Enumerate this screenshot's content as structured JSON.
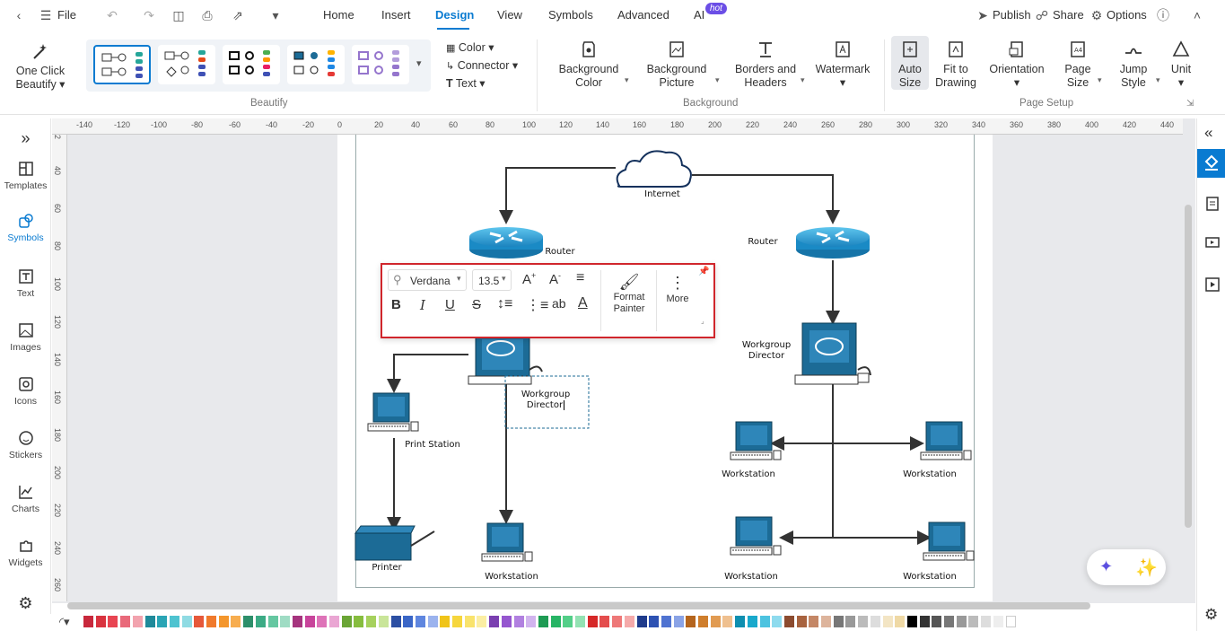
{
  "topbar": {
    "file": "File",
    "tabs": [
      "Home",
      "Insert",
      "Design",
      "View",
      "Symbols",
      "Advanced",
      "AI"
    ],
    "ai_badge": "hot",
    "active_tab": "Design",
    "publish": "Publish",
    "share": "Share",
    "options": "Options"
  },
  "ribbon": {
    "one_click_beautify": [
      "One Click",
      "Beautify"
    ],
    "color": "Color",
    "connector": "Connector",
    "text": "Text",
    "beautify_label": "Beautify",
    "background_color": [
      "Background",
      "Color"
    ],
    "background_picture": [
      "Background",
      "Picture"
    ],
    "borders_headers": [
      "Borders and",
      "Headers"
    ],
    "watermark": "Watermark",
    "background_label": "Background",
    "auto_size": [
      "Auto",
      "Size"
    ],
    "fit_to_drawing": [
      "Fit to",
      "Drawing"
    ],
    "orientation": "Orientation",
    "page_size": [
      "Page",
      "Size"
    ],
    "jump_style": [
      "Jump",
      "Style"
    ],
    "unit": "Unit",
    "page_setup_label": "Page Setup"
  },
  "leftbar": [
    "Templates",
    "Symbols",
    "Text",
    "Images",
    "Icons",
    "Stickers",
    "Charts",
    "Widgets"
  ],
  "ruler_top": [
    "-140",
    "-120",
    "-100",
    "-80",
    "-60",
    "-40",
    "-20",
    "0",
    "20",
    "40",
    "60",
    "80",
    "100",
    "120",
    "140",
    "160",
    "180",
    "200",
    "220",
    "240",
    "260",
    "280",
    "300",
    "320",
    "340",
    "360",
    "380",
    "400",
    "420",
    "440"
  ],
  "ruler_left": [
    "2",
    "40",
    "60",
    "80",
    "100",
    "120",
    "140",
    "160",
    "180",
    "200",
    "220",
    "240",
    "260"
  ],
  "diagram": {
    "internet": "Internet",
    "router_left": "Router",
    "router_right": "Router",
    "workgroup_director_left": [
      "Workgroup",
      "Director"
    ],
    "workgroup_director_right": [
      "Workgroup",
      "Director"
    ],
    "print_station": "Print Station",
    "printer": "Printer",
    "workstation": "Workstation"
  },
  "textbar": {
    "font": "Verdana",
    "size": "13.5",
    "format_painter": [
      "Format",
      "Painter"
    ],
    "more": "More"
  },
  "colors": {
    "accent": "#0a7bd1",
    "highlight_border": "#d0262c",
    "device_blue": "#1c6b96"
  },
  "palette": [
    "#c8283c",
    "#d9333f",
    "#e84552",
    "#e9697a",
    "#f2a3ae",
    "#1f8a9a",
    "#2aa5b5",
    "#4ec3d0",
    "#8fdbe3",
    "#e6583a",
    "#f07a2c",
    "#f4962c",
    "#f7ad4f",
    "#2d8f6a",
    "#3cab85",
    "#65c7a1",
    "#9fdcc4",
    "#a6347e",
    "#c8449b",
    "#de73b8",
    "#eaa6d3",
    "#6aa535",
    "#86bd3e",
    "#a6d15d",
    "#c9e599",
    "#2c4fa3",
    "#3a66c7",
    "#5f86df",
    "#9bb3ee",
    "#f0c419",
    "#f6d63d",
    "#f9e36c",
    "#fbeea3",
    "#7a3fb0",
    "#9556cf",
    "#b180e0",
    "#d1b4ee",
    "#1e9b54",
    "#27b565",
    "#53cf88",
    "#93e2b3",
    "#d62828",
    "#e44d4d",
    "#ee7878",
    "#f5aaaa",
    "#1f3b8c",
    "#2d52b3",
    "#4f73d1",
    "#8aa3e6",
    "#b5651d",
    "#cf7e2c",
    "#e19b52",
    "#efc08f",
    "#0e8fb0",
    "#19a9cc",
    "#4cc3e0",
    "#8edbee",
    "#8c4b2f",
    "#a8633f",
    "#c48766",
    "#ddb49c",
    "#777777",
    "#999999",
    "#bbbbbb",
    "#dddddd",
    "#f3e5c4",
    "#efd9a5",
    "#000000",
    "#333333",
    "#555555",
    "#777777",
    "#999999",
    "#bbbbbb",
    "#dddddd",
    "#eeeeee",
    "#ffffff"
  ]
}
